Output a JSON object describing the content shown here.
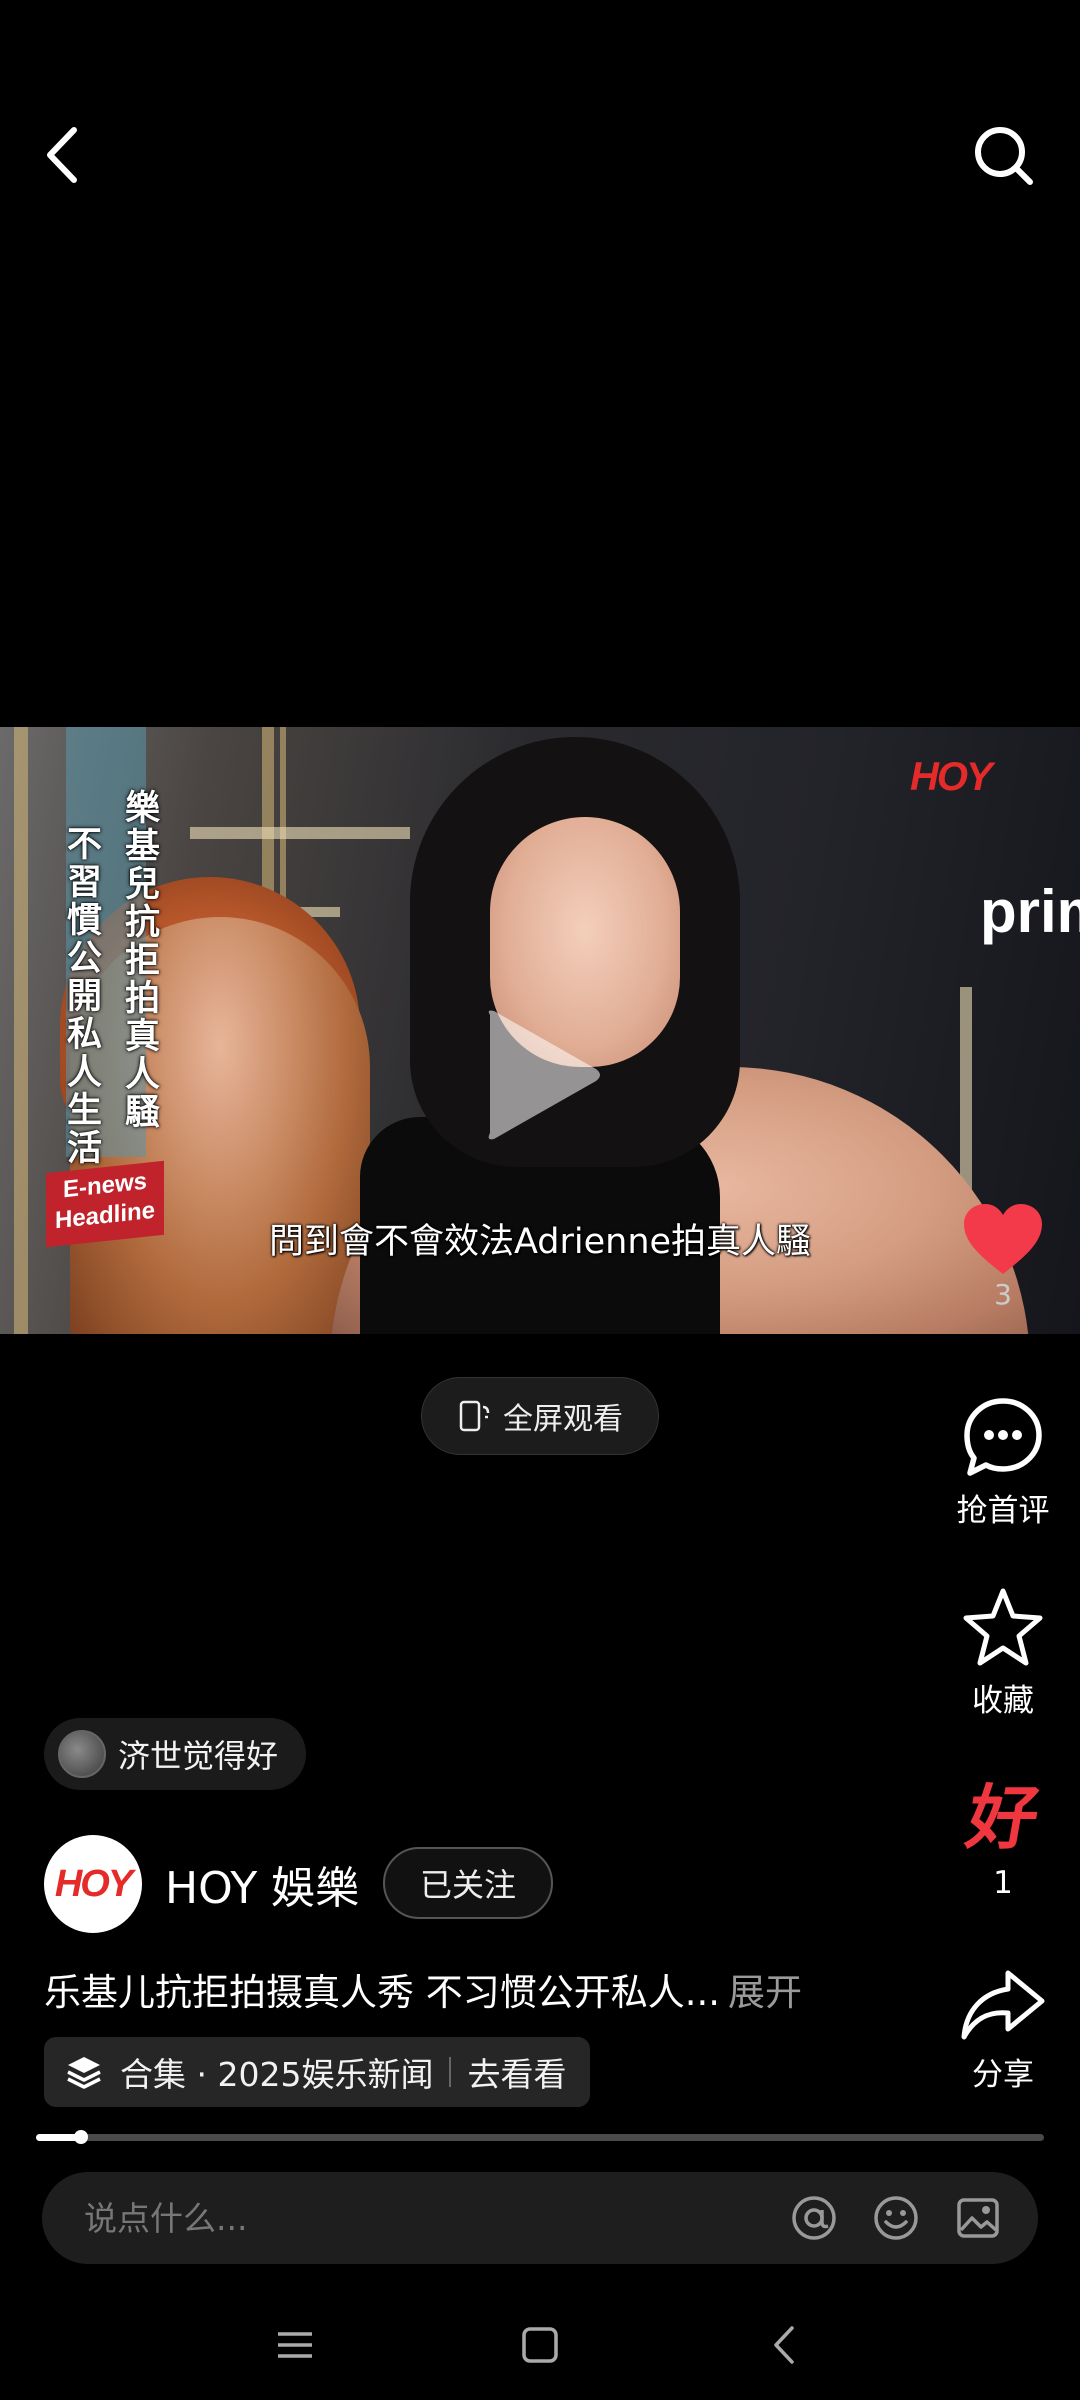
{
  "video": {
    "channel_watermark": "HOY",
    "vertical_caption_1": "樂基兒抗拒拍真人騷",
    "vertical_caption_2": "不習慣公開私人生活",
    "badge_line_1": "E-news",
    "badge_line_2": "Headline",
    "background_text": "prim",
    "subtitle": "問到會不會效法Adrienne拍真人騷"
  },
  "fullscreen": {
    "label": "全屏观看"
  },
  "sidebar": {
    "like_count": "3",
    "comment_label": "抢首评",
    "favorite_label": "收藏",
    "good_icon_text": "好",
    "good_count": "1",
    "share_label": "分享"
  },
  "recommender": {
    "name": "济世觉得好"
  },
  "author": {
    "avatar_text": "HOY",
    "name": "HOY 娛樂",
    "follow_label": "已关注"
  },
  "post": {
    "title": "乐基儿抗拒拍摄真人秀 不习惯公开私人...",
    "expand_label": "展开"
  },
  "collection": {
    "label": "合集 · 2025娱乐新闻",
    "action": "去看看"
  },
  "progress": {
    "fraction": 0.045
  },
  "comment_bar": {
    "placeholder": "说点什么..."
  },
  "colors": {
    "like_red": "#f23a4a",
    "good_red": "#f0373f",
    "background": "#000000"
  }
}
